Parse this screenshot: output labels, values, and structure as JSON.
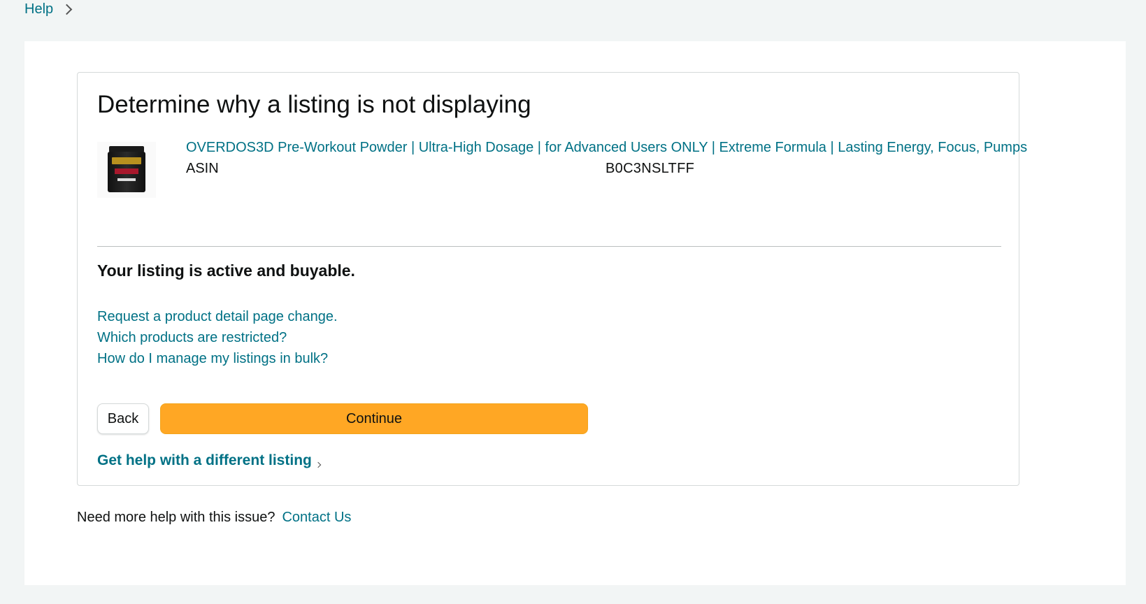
{
  "breadcrumb": {
    "help_label": "Help"
  },
  "card": {
    "title": "Determine why a listing is not displaying",
    "product": {
      "image_icon": "product-jar-image",
      "title": "OVERDOS3D Pre-Workout Powder | Ultra-High Dosage | for Advanced Users ONLY | Extreme Formula | Lasting Energy, Focus, Pumps",
      "asin_label": "ASIN",
      "asin_value": "B0C3NSLTFF"
    },
    "status": "Your listing is active and buyable.",
    "links": [
      "Request a product detail page change.",
      "Which products are restricted?",
      "How do I manage my listings in bulk?"
    ],
    "back_label": "Back",
    "continue_label": "Continue",
    "different_listing_label": "Get help with a different listing"
  },
  "footer": {
    "question": "Need more help with this issue?",
    "contact_label": "Contact Us"
  },
  "colors": {
    "link": "#007185",
    "primary_button": "#ffa724",
    "page_background": "#f2f5f5"
  }
}
